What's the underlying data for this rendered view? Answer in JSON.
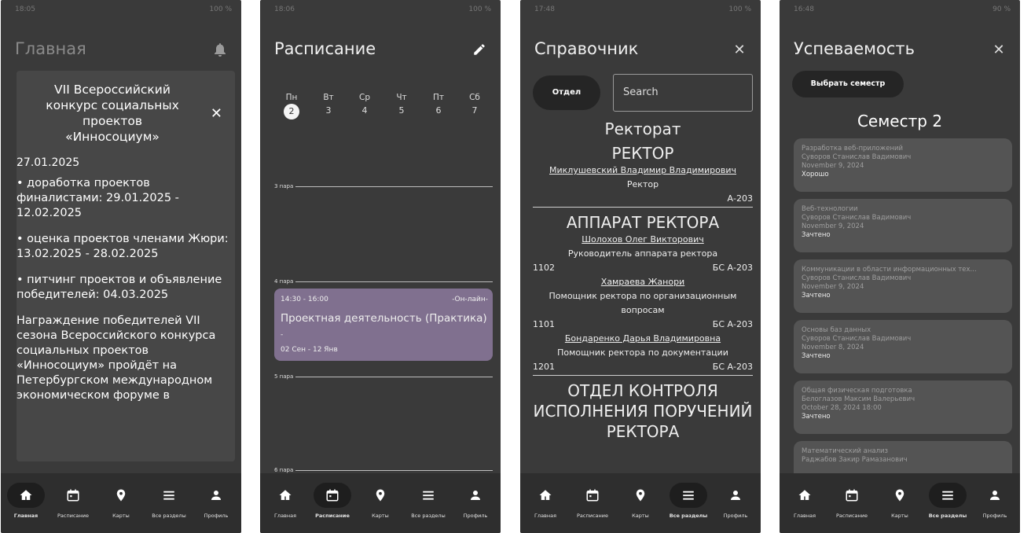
{
  "screens": {
    "home": {
      "status_time": "18:05",
      "status_right": "100 %",
      "title": "Главная",
      "card_title": "VII Всероссийский конкурс социальных проектов «Инносоциум»",
      "date_cut": "27.01.2025",
      "paragraphs": [
        "• доработка проектов финалистами: 29.01.2025 - 12.02.2025",
        "• оценка проектов членами Жюри: 13.02.2025 - 28.02.2025",
        "• питчинг проектов и объявление победителей: 04.03.2025",
        "Награждение победителей VII сезона Всероссийского конкурса социальных проектов «Инносоциум» пройдёт на Петербургском международном экономическом форуме в"
      ]
    },
    "schedule": {
      "status_time": "18:06",
      "status_right": "100 %",
      "title": "Расписание",
      "days": [
        {
          "name": "Пн",
          "num": "2"
        },
        {
          "name": "Вт",
          "num": "3"
        },
        {
          "name": "Ср",
          "num": "4"
        },
        {
          "name": "Чт",
          "num": "5"
        },
        {
          "name": "Пт",
          "num": "6"
        },
        {
          "name": "Сб",
          "num": "7"
        }
      ],
      "pairs": [
        "3 пара",
        "4 пара",
        "5 пара",
        "6 пара"
      ],
      "lesson": {
        "time": "14:30 - 16:00",
        "mode": "-Он-лайн-",
        "name": "Проектная деятельность (Практика)",
        "dash": "-",
        "range": "02 Сен - 12 Янв"
      }
    },
    "directory": {
      "status_time": "17:48",
      "status_right": "100 %",
      "title": "Справочник",
      "otdel_label": "Отдел",
      "search_placeholder": "Search",
      "rektorat": "Ректорат",
      "rektor_head": "РЕКТОР",
      "rektor_name": "Миклушевский Владимир Владимирович",
      "rektor_role": "Ректор",
      "rektor_room": "А-203",
      "apparat_head": "АППАРАТ РЕКТОРА",
      "people": [
        {
          "name": "Шолохов Олег Викторович",
          "role": "Руководитель аппарата ректора",
          "phone": "1102",
          "room": "БС А-203"
        },
        {
          "name": "Хамраева Жанори",
          "role": "Помощник ректора по организационным вопросам",
          "phone": "1101",
          "room": "БС А-203"
        },
        {
          "name": "Бондаренко Дарья Владимировна",
          "role": "Помощник ректора по документации",
          "phone": "1201",
          "room": "БС А-203"
        }
      ],
      "next_head": "ОТДЕЛ КОНТРОЛЯ ИСПОЛНЕНИЯ ПОРУЧЕНИЙ РЕКТОРА"
    },
    "grades": {
      "status_time": "16:48",
      "status_right": "90 %",
      "title": "Успеваемость",
      "semester_button": "Выбрать семестр",
      "semester_title": "Семестр 2",
      "subjects": [
        {
          "name": "Разработка веб-приложений",
          "teacher": "Суворов Станислав Вадимович",
          "date": "November 9, 2024",
          "grade": "Хорошо"
        },
        {
          "name": "Веб-технологии",
          "teacher": "Суворов Станислав Вадимович",
          "date": "November 9, 2024",
          "grade": "Зачтено"
        },
        {
          "name": "Коммуникации в области информационных тех...",
          "teacher": "Суворов Станислав Вадимович",
          "date": "November 9, 2024",
          "grade": "Зачтено"
        },
        {
          "name": "Основы баз данных",
          "teacher": "Суворов Станислав Вадимович",
          "date": "November 8, 2024",
          "grade": "Зачтено"
        },
        {
          "name": "Общая физическая подготовка",
          "teacher": "Белоглазов Максим Валерьевич",
          "date": "October 28, 2024 18:00",
          "grade": "Зачтено"
        },
        {
          "name": "Математический анализ",
          "teacher": "Раджабов Закир Рамазанович",
          "date": "",
          "grade": ""
        }
      ]
    }
  },
  "nav": {
    "home": "Главная",
    "schedule": "Расписание",
    "maps": "Карты",
    "sections": "Все разделы",
    "profile": "Профиль"
  },
  "colors": {
    "background": "#3a3a3a",
    "navbar": "#2e2e2e",
    "lesson": "#80708f",
    "card": "#545454"
  },
  "icons": [
    "bell-icon",
    "pencil-icon",
    "close-icon",
    "home-icon",
    "calendar-icon",
    "map-pin-icon",
    "menu-icon",
    "person-icon"
  ]
}
